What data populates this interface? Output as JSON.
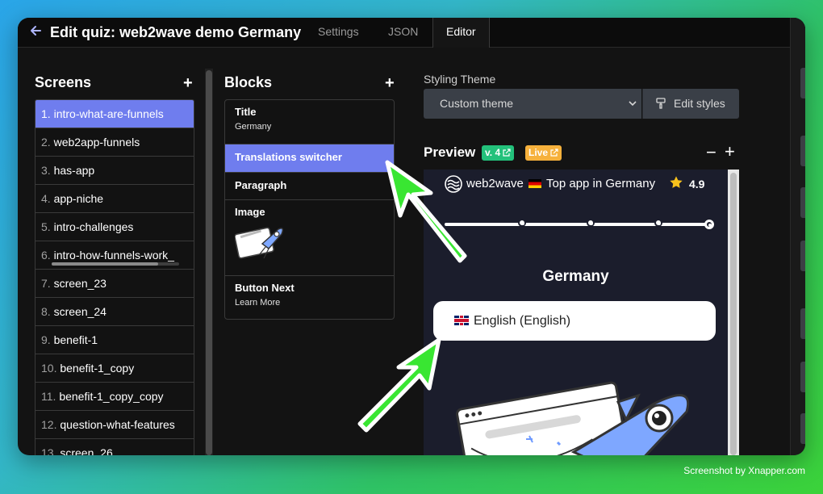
{
  "header": {
    "title": "Edit quiz: web2wave demo Germany",
    "tabs": [
      {
        "label": "Settings",
        "active": false
      },
      {
        "label": "JSON",
        "active": false
      },
      {
        "label": "Editor",
        "active": true
      }
    ]
  },
  "screens": {
    "heading": "Screens",
    "add_label": "+",
    "items": [
      {
        "num": "1.",
        "name": "intro-what-are-funnels",
        "active": true
      },
      {
        "num": "2.",
        "name": "web2app-funnels",
        "active": false
      },
      {
        "num": "3.",
        "name": "has-app",
        "active": false
      },
      {
        "num": "4.",
        "name": "app-niche",
        "active": false
      },
      {
        "num": "5.",
        "name": "intro-challenges",
        "active": false
      },
      {
        "num": "6.",
        "name": "intro-how-funnels-work_",
        "active": false
      },
      {
        "num": "7.",
        "name": "screen_23",
        "active": false
      },
      {
        "num": "8.",
        "name": "screen_24",
        "active": false
      },
      {
        "num": "9.",
        "name": "benefit-1",
        "active": false
      },
      {
        "num": "10.",
        "name": "benefit-1_copy",
        "active": false
      },
      {
        "num": "11.",
        "name": "benefit-1_copy_copy",
        "active": false
      },
      {
        "num": "12.",
        "name": "question-what-features",
        "active": false
      },
      {
        "num": "13.",
        "name": "screen_26",
        "active": false
      }
    ]
  },
  "blocks": {
    "heading": "Blocks",
    "add_label": "+",
    "items": [
      {
        "name": "Title",
        "sub": "Germany",
        "active": false
      },
      {
        "name": "Translations switcher",
        "sub": "",
        "active": true
      },
      {
        "name": "Paragraph",
        "sub": "",
        "active": false
      },
      {
        "name": "Image",
        "sub": "",
        "active": false
      },
      {
        "name": "Button Next",
        "sub": "Learn More",
        "active": false
      }
    ]
  },
  "styling": {
    "label": "Styling Theme",
    "selected_theme": "Custom theme",
    "edit_button": "Edit styles"
  },
  "preview": {
    "label": "Preview",
    "version_badge": "v. 4",
    "live_badge": "Live",
    "zoom_out": "−",
    "zoom_in": "+",
    "brand": "web2wave",
    "top_app": "Top app in Germany",
    "rating": "4.9",
    "progress": {
      "steps": 5,
      "current_step": 5
    },
    "title": "Germany",
    "language_button": "English (English)"
  },
  "watermark": "Screenshot by Xnapper.com",
  "colors": {
    "accent": "#6f7dee",
    "version_badge": "#23c17b",
    "live_badge": "#f6b13c",
    "arrow": "#39e632"
  }
}
